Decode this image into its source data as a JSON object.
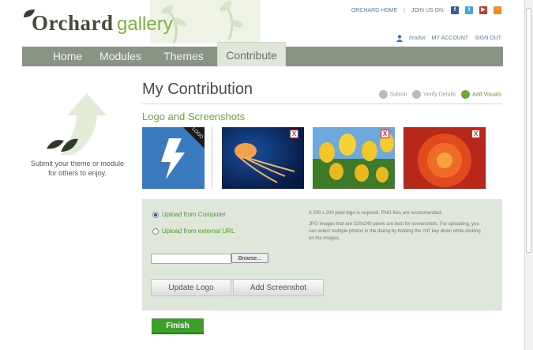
{
  "brand": {
    "name_part1": "Orchard",
    "name_part2": "gallery"
  },
  "top_links": {
    "home": "ORCHARD HOME",
    "join": "JOIN US ON:"
  },
  "user": {
    "name": "bradwi",
    "account": "MY ACCOUNT",
    "signout": "SIGN OUT"
  },
  "nav": {
    "items": [
      {
        "label": "Home"
      },
      {
        "label": "Modules"
      },
      {
        "label": "Themes"
      },
      {
        "label": "Contribute"
      }
    ]
  },
  "sidebar": {
    "text": "Submit your theme or module for others to enjoy."
  },
  "main": {
    "title": "My Contribution",
    "steps": [
      {
        "label": "Submit",
        "active": false
      },
      {
        "label": "Verify Details",
        "active": false
      },
      {
        "label": "Add Visuals",
        "active": true
      }
    ],
    "section_title": "Logo and Screenshots",
    "logo_badge": "LOGO",
    "remove_glyph": "X"
  },
  "upload": {
    "options": [
      {
        "label": "Upload from Computer",
        "selected": true
      },
      {
        "label": "Upload from external URL",
        "selected": false
      }
    ],
    "info1": "A 200 x 200 pixel logo is required. PNG files are recommended.",
    "info2": "JPG Images that are 320x240 pixels are best for screenshots. For uploading, you can select multiple photos in the dialog by holding the 'ctrl' key down while clicking on the images.",
    "file_value": "",
    "browse_label": "Browse...",
    "update_logo_label": "Update Logo",
    "add_screenshot_label": "Add Screenshot"
  },
  "finish_label": "Finish",
  "colors": {
    "accent_green": "#6aaa2f",
    "nav_bg": "#8a9484",
    "panel_bg": "#dfe6da",
    "finish_green": "#3e9e2c",
    "link_blue": "#4d7fb0"
  }
}
